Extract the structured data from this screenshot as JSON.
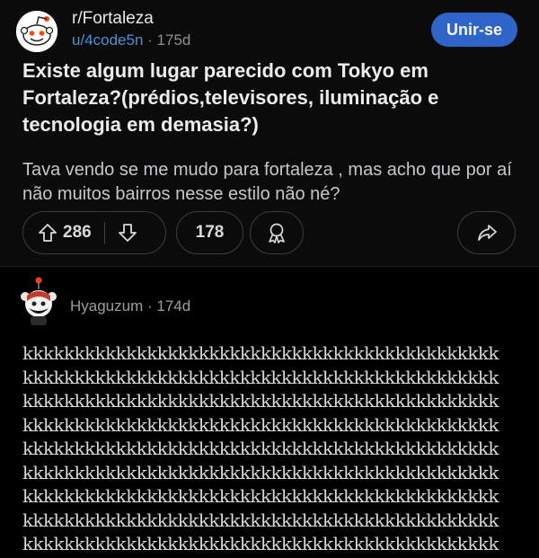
{
  "post": {
    "subreddit": "r/Fortaleza",
    "author": "u/4code5n",
    "age": "175d",
    "join_label": "Unir-se",
    "title": "Existe algum lugar parecido com Tokyo em Fortaleza?(prédios,televisores, iluminação e tecnologia em demasia?)",
    "body": "Tava vendo se me mudo para fortaleza , mas acho que por aí não muitos bairros nesse estilo não né?",
    "upvotes": "286",
    "comments": "178",
    "icons": [
      "snoo-avatar-icon",
      "upvote-icon",
      "downvote-icon",
      "award-icon",
      "share-icon"
    ]
  },
  "comment": {
    "author": "Hyaguzum",
    "age": "174d",
    "lines": [
      "kkkkkkkkkkkkkkkkkkkkkkkkkkkkkkkkkkkkkkkkkkkkkk",
      "kkkkkkkkkkkkkkkkkkkkkkkkkkkkkkkkkkkkkkkkkkkkkk",
      "kkkkkkkkkkkkkkkkkkkkkkkkkkkkkkkkkkkkkkkkkkkkkk",
      "kkkkkkkkkkkkkkkkkkkkkkkkkkkkkkkkkkkkkkkkkkkkkk",
      "kkkkkkkkkkkkkkkkkkkkkkkkkkkkkkkkkkkkkkkkkkkkkk",
      "kkkkkkkkkkkkkkkkkkkkkkkkkkkkkkkkkkkkkkkkkkkkkk",
      "kkkkkkkkkkkkkkkkkkkkkkkkkkkkkkkkkkkkkkkkkkkkkk",
      "kkkkkkkkkkkkkkkkkkkkkkkkkkkkkkkkkkkkkkkkkkkkkk",
      "kkkkkkkkkkkkkkkkkkkkkkkkkkkkkkkkkkkkkkkkkkkkkk"
    ],
    "icons": [
      "commenter-avatar-icon"
    ]
  },
  "colors": {
    "background": "#000000",
    "post_background": "#0b0b0b",
    "join_button": "#2f64c8",
    "username_link": "#4f8fd6",
    "snoo_accent": "#ff4500"
  }
}
